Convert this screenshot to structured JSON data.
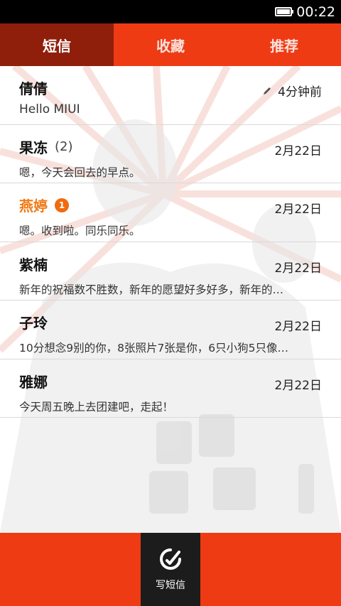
{
  "status_bar": {
    "time": "00:22",
    "battery_icon": "battery-icon"
  },
  "tabs": [
    {
      "label": "短信",
      "active": true
    },
    {
      "label": "收藏",
      "active": false
    },
    {
      "label": "推荐",
      "active": false
    }
  ],
  "messages": [
    {
      "name": "倩倩",
      "count": "",
      "badge": "",
      "time": "4分钟前",
      "draft": true,
      "preview": "Hello MIUI"
    },
    {
      "name": "果冻",
      "count": "(2)",
      "badge": "",
      "time": "2月22日",
      "draft": false,
      "preview": "嗯，今天会回去的早点。"
    },
    {
      "name": "燕婷",
      "count": "",
      "badge": "1",
      "time": "2月22日",
      "draft": false,
      "preview": "嗯。收到啦。同乐同乐。"
    },
    {
      "name": "紫楠",
      "count": "",
      "badge": "",
      "time": "2月22日",
      "draft": false,
      "preview": "新年的祝福数不胜数，新年的愿望好多好多，新年的…"
    },
    {
      "name": "子玲",
      "count": "",
      "badge": "",
      "time": "2月22日",
      "draft": false,
      "preview": "10分想念9别的你，8张照片7张是你，6只小狗5只像…"
    },
    {
      "name": "雅娜",
      "count": "",
      "badge": "",
      "time": "2月22日",
      "draft": false,
      "preview": "今天周五晚上去团建吧，走起！"
    }
  ],
  "bottom_bar": {
    "compose_label": "写短信",
    "compose_icon": "compose-icon"
  },
  "colors": {
    "accent": "#ee3b14",
    "active_tab": "#8f1f0b",
    "unread": "#f07a16",
    "compose_bg": "#1c1c1c"
  }
}
